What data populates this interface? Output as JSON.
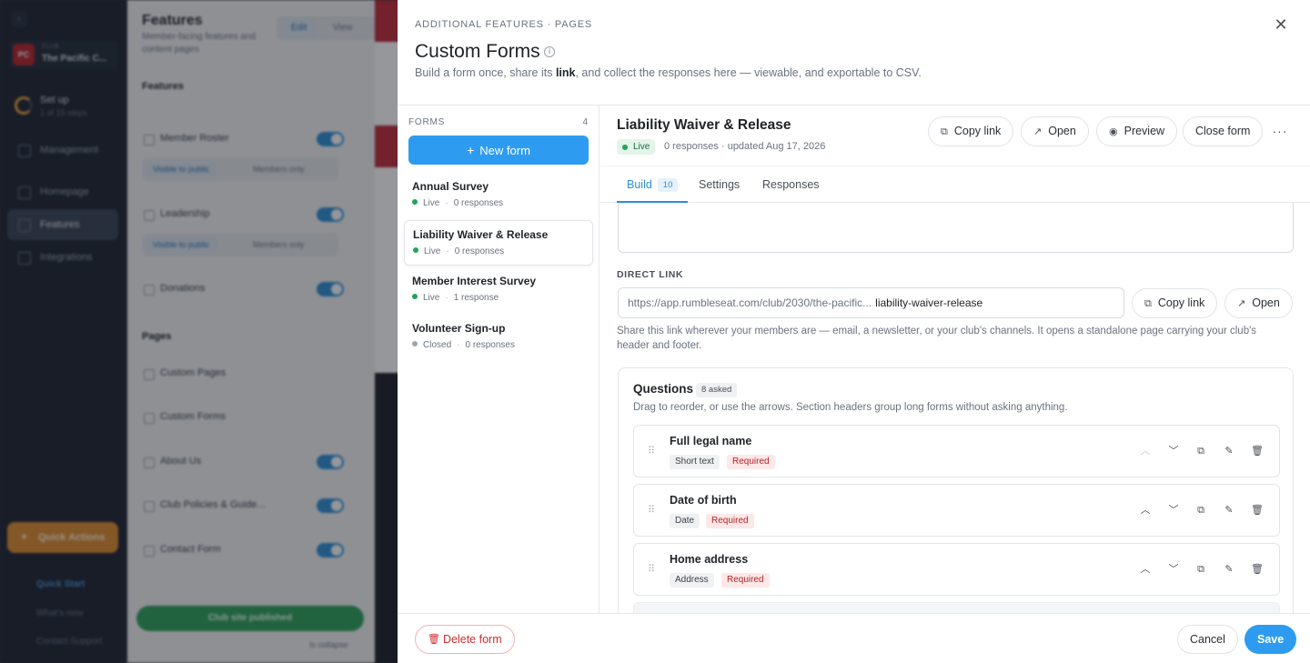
{
  "background": {
    "collapse_glyph": "‹",
    "club": {
      "logo": "PC",
      "small": "CLUB",
      "name": "The Pacific C..."
    },
    "setup": {
      "title": "Set up",
      "progress": "1 of 15 steps"
    },
    "nav": [
      "Management",
      "Homepage",
      "Features",
      "Integrations"
    ],
    "quick_actions": "Quick Actions",
    "footer_links": [
      "Quick Start",
      "What's new",
      "Contact Support"
    ],
    "page_title": "Features",
    "page_sub": "Member-facing features and content pages",
    "seg": [
      "Edit",
      "View"
    ],
    "section_features": "Features",
    "section_pages": "Pages",
    "rows": [
      "Member Roster",
      "Leadership",
      "Donations",
      "Custom Pages",
      "Custom Forms",
      "About Us",
      "Club Policies & Guide...",
      "Contact Form"
    ],
    "pills": [
      "Visible to public",
      "Members only"
    ],
    "published": "Club site published",
    "collapse_label": "Is collapse"
  },
  "modal": {
    "eyebrow": "ADDITIONAL FEATURES · PAGES",
    "title": "Custom Forms",
    "subtitle_before": "Build a form once, share its ",
    "subtitle_link": "link",
    "subtitle_after": ", and collect the responses here — viewable, and exportable to CSV.",
    "close_glyph": "✕"
  },
  "forms_list": {
    "label": "FORMS",
    "count": "4",
    "new_form": "New form",
    "items": [
      {
        "name": "Annual Survey",
        "status": "Live",
        "responses": "0 responses"
      },
      {
        "name": "Liability Waiver & Release",
        "status": "Live",
        "responses": "0 responses"
      },
      {
        "name": "Member Interest Survey",
        "status": "Live",
        "responses": "1 response"
      },
      {
        "name": "Volunteer Sign-up",
        "status": "Closed",
        "responses": "0 responses"
      }
    ]
  },
  "detail": {
    "title": "Liability Waiver & Release",
    "status": "Live",
    "meta": "0 responses · updated Aug 17, 2026",
    "actions": {
      "copy_link": "Copy link",
      "open": "Open",
      "preview": "Preview",
      "close_form": "Close form",
      "more": "···"
    },
    "tabs": [
      {
        "label": "Build",
        "count": "10"
      },
      {
        "label": "Settings"
      },
      {
        "label": "Responses"
      }
    ],
    "direct_link_label": "DIRECT LINK",
    "link_base": "https://app.rumbleseat.com/club/2030/the-pacific...",
    "link_slug": "liability-waiver-release",
    "link_copy": "Copy link",
    "link_open": "Open",
    "link_help": "Share this link wherever your members are — email, a newsletter, or your club's channels. It opens a standalone page carrying your club's header and footer.",
    "questions": {
      "title": "Questions",
      "asked": "8 asked",
      "help": "Drag to reorder, or use the arrows. Section headers group long forms without asking anything.",
      "items": [
        {
          "name": "Full legal name",
          "type": "Short text",
          "required": "Required"
        },
        {
          "name": "Date of birth",
          "type": "Date",
          "required": "Required"
        },
        {
          "name": "Home address",
          "type": "Address",
          "required": "Required"
        }
      ]
    }
  },
  "footer": {
    "delete": "Delete form",
    "cancel": "Cancel",
    "save": "Save"
  },
  "colors": {
    "accent": "#2d9cf0",
    "live": "#22a35a",
    "danger": "#d12c2c",
    "brand": "#b8202b"
  }
}
